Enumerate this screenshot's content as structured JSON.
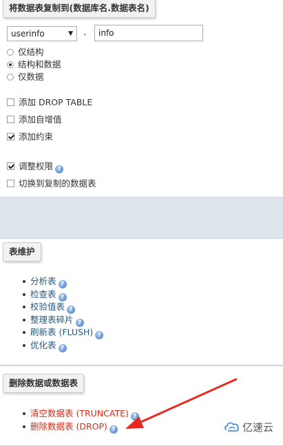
{
  "copy_section": {
    "legend": "将数据表复制到(数据库名.数据表名)",
    "db_select": "userinfo",
    "separator": ".",
    "table_name": "info",
    "radios": [
      {
        "label": "仅结构",
        "checked": false
      },
      {
        "label": "结构和数据",
        "checked": true
      },
      {
        "label": "仅数据",
        "checked": false
      }
    ],
    "checks1": [
      {
        "label": "添加 DROP TABLE",
        "checked": false
      },
      {
        "label": "添加自增值",
        "checked": false
      },
      {
        "label": "添加约束",
        "checked": true
      }
    ],
    "checks2": [
      {
        "label": "调整权限",
        "checked": true
      },
      {
        "label": "切换到复制的数据表",
        "checked": false
      }
    ]
  },
  "maintenance": {
    "legend": "表维护",
    "items": [
      "分析表",
      "检查表",
      "校验值表",
      "整理表碎片",
      "刷新表 (FLUSH)",
      "优化表"
    ]
  },
  "delete_section": {
    "legend": "删除数据或数据表",
    "items": [
      "清空数据表 (TRUNCATE)",
      "删除数据表 (DROP)"
    ]
  },
  "watermark": {
    "text": "亿速云"
  },
  "colors": {
    "link": "#235a81",
    "danger": "#d62a1a",
    "arrow": "#e8281e",
    "background": "#dde4ec"
  }
}
